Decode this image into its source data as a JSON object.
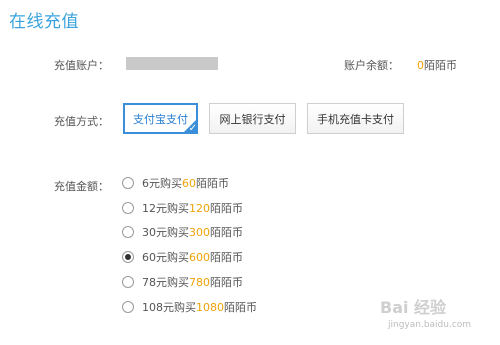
{
  "page": {
    "title": "在线充值"
  },
  "account": {
    "label": "充值账户：",
    "balance_label": "账户余额：",
    "balance_value": "0",
    "balance_unit": "陌陌币"
  },
  "method": {
    "label": "充值方式：",
    "options": [
      {
        "label": "支付宝支付",
        "selected": true
      },
      {
        "label": "网上银行支付",
        "selected": false
      },
      {
        "label": "手机充值卡支付",
        "selected": false
      }
    ]
  },
  "amount": {
    "label": "充值金额：",
    "options": [
      {
        "prefix": "6元购买",
        "coins": "60",
        "suffix": "陌陌币",
        "selected": false
      },
      {
        "prefix": "12元购买",
        "coins": "120",
        "suffix": "陌陌币",
        "selected": false
      },
      {
        "prefix": "30元购买",
        "coins": "300",
        "suffix": "陌陌币",
        "selected": false
      },
      {
        "prefix": "60元购买",
        "coins": "600",
        "suffix": "陌陌币",
        "selected": true
      },
      {
        "prefix": "78元购买",
        "coins": "780",
        "suffix": "陌陌币",
        "selected": false
      },
      {
        "prefix": "108元购买",
        "coins": "1080",
        "suffix": "陌陌币",
        "selected": false
      }
    ]
  },
  "watermark": {
    "main": "Bai 经验",
    "sub": "jingyan.baidu.com"
  },
  "colors": {
    "accent": "#3a8fd8",
    "title": "#3aa3dd",
    "coins": "#f0a30a"
  }
}
